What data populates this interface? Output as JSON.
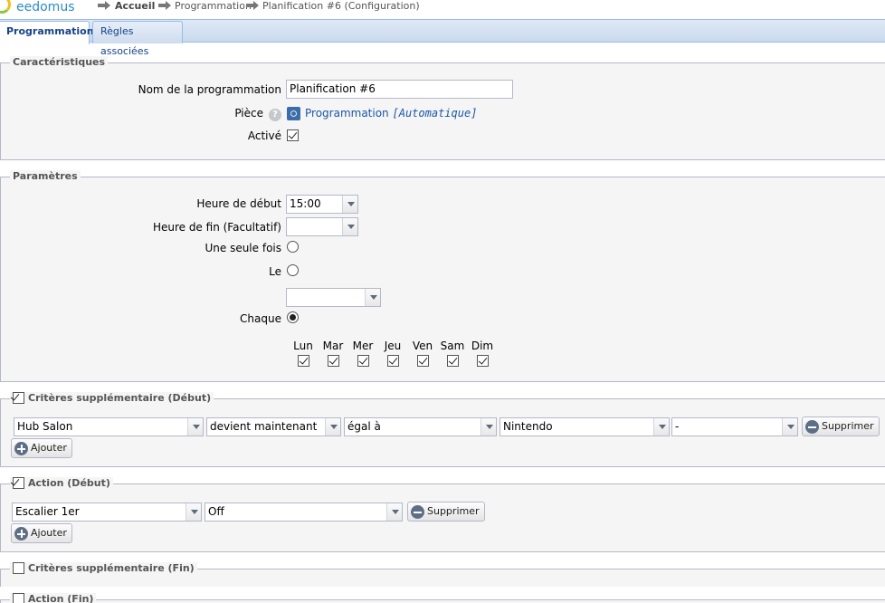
{
  "app": {
    "logo_text": "eedomus"
  },
  "breadcrumb": [
    "Accueil",
    "Programmation",
    "Planification #6 (Configuration)"
  ],
  "tabs": [
    {
      "label": "Programmation",
      "active": true
    },
    {
      "label": "Règles associées",
      "active": false
    }
  ],
  "characteristics": {
    "title": "Caractéristiques",
    "name_label": "Nom de la programmation",
    "name_value": "Planification #6",
    "room_label": "Pièce",
    "room_help": "?",
    "room_value": "Programmation",
    "room_suffix": "[Automatique]",
    "active_label": "Activé",
    "active_checked": true
  },
  "parameters": {
    "title": "Paramètres",
    "start_label": "Heure de début",
    "start_value": "15:00",
    "end_label": "Heure de fin (Facultatif)",
    "end_value": "",
    "once_label": "Une seule fois",
    "on_label": "Le",
    "on_date_value": "",
    "every_label": "Chaque",
    "selected_mode": "Chaque",
    "days": [
      "Lun",
      "Mar",
      "Mer",
      "Jeu",
      "Ven",
      "Sam",
      "Dim"
    ],
    "days_checked": [
      true,
      true,
      true,
      true,
      true,
      true,
      true
    ]
  },
  "criteria_start": {
    "title": "Critères supplémentaire (Début)",
    "enabled": true,
    "row": {
      "device": "Hub Salon",
      "condition": "devient maintenant",
      "operator": "égal à",
      "value": "Nintendo",
      "extra": "-"
    },
    "delete_label": "Supprimer",
    "add_label": "Ajouter"
  },
  "action_start": {
    "title": "Action (Début)",
    "enabled": true,
    "row": {
      "device": "Escalier 1er",
      "value": "Off"
    },
    "delete_label": "Supprimer",
    "add_label": "Ajouter"
  },
  "criteria_end": {
    "title": "Critères supplémentaire (Fin)",
    "enabled": false
  },
  "action_end": {
    "title": "Action (Fin)",
    "enabled": false
  },
  "colors": {
    "tab_text": "#15428b",
    "link": "#1a56a8",
    "border": "#b5b8c8",
    "panel_bg": "#f5f5f5"
  }
}
